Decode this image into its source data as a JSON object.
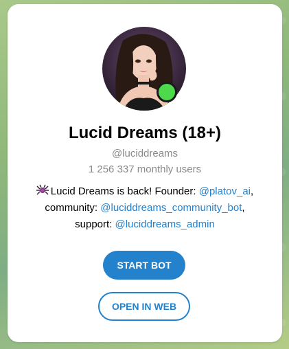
{
  "bot": {
    "title": "Lucid Dreams (18+)",
    "username": "@luciddreams",
    "monthly_users": "1 256 337 monthly users",
    "avatar_icon": "bot-avatar-icon",
    "online_indicator_color": "#4cd94c"
  },
  "description": {
    "emoji_icon": "spider-emoji-icon",
    "intro": "Lucid Dreams is back! Founder: ",
    "founder_link": "@platov_ai",
    "comma": ",",
    "community_label": "community: ",
    "community_link": "@luciddreams_community_bot",
    "support_label": "support: ",
    "support_link": "@luciddreams_admin"
  },
  "actions": {
    "start_label": "START BOT",
    "web_label": "OPEN IN WEB"
  },
  "colors": {
    "accent": "#2481cc",
    "muted_text": "#8a8a8a",
    "background_green": "#8fb87a"
  }
}
